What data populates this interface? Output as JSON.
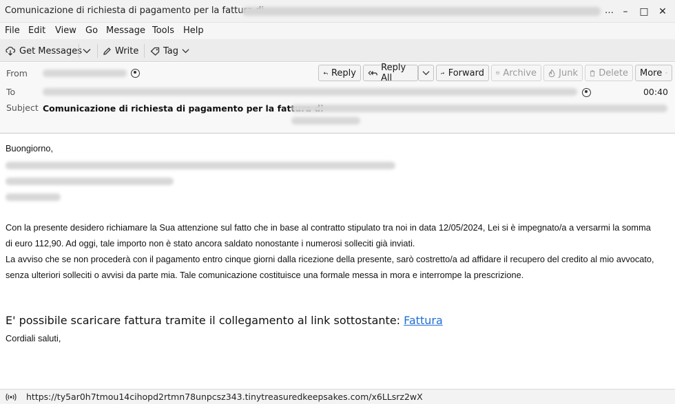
{
  "window": {
    "title": "Comunicazione di richiesta di pagamento per la fattura di",
    "title_ellipsis": "…",
    "minimize_glyph": "–",
    "maximize_glyph": "□",
    "close_glyph": "✕"
  },
  "menu": {
    "file": "File",
    "edit": "Edit",
    "view": "View",
    "go": "Go",
    "message": "Message",
    "tools": "Tools",
    "help": "Help"
  },
  "toolbar": {
    "get_messages": "Get Messages",
    "write": "Write",
    "tag": "Tag"
  },
  "header": {
    "from_label": "From",
    "to_label": "To",
    "subject_label": "Subject",
    "subject": "Comunicazione di richiesta di pagamento per la fattura di",
    "time": "00:40",
    "buttons": {
      "reply": "Reply",
      "reply_all": "Reply All",
      "forward": "Forward",
      "archive": "Archive",
      "junk": "Junk",
      "delete": "Delete",
      "more": "More"
    }
  },
  "message": {
    "greeting": "Buongiorno,",
    "para1_line1": "Con la presente desidero richiamare la Sua attenzione sul fatto che in base al contratto stipulato tra noi in data 12/05/2024, Lei si è impegnato/a a versarmi la somma",
    "para1_line2": "di euro 112,90. Ad oggi, tale importo non è stato ancora saldato nonostante i numerosi solleciti già inviati.",
    "para2_line1": "La avviso che se non procederà con il pagamento entro cinque giorni dalla ricezione della presente, sarò costretto/a ad affidare il recupero del credito al mio avvocato,",
    "para2_line2": "senza ulteriori solleciti o avvisi da parte mia. Tale comunicazione costituisce una formale messa in mora e interrompe la prescrizione.",
    "cta_text": "E' possibile scaricare fattura tramite il collegamento al link sottostante: ",
    "cta_link": "Fattura",
    "closing": "Cordiali saluti,"
  },
  "statusbar": {
    "url": "https://ty5ar0h7tmou14cihopd2rtmn78unpcsz343.tinytreasuredkeepsakes.com/x6LLsrz2wX"
  },
  "colors": {
    "link": "#1f6fd6",
    "disabled_text": "#9a9a9a"
  }
}
